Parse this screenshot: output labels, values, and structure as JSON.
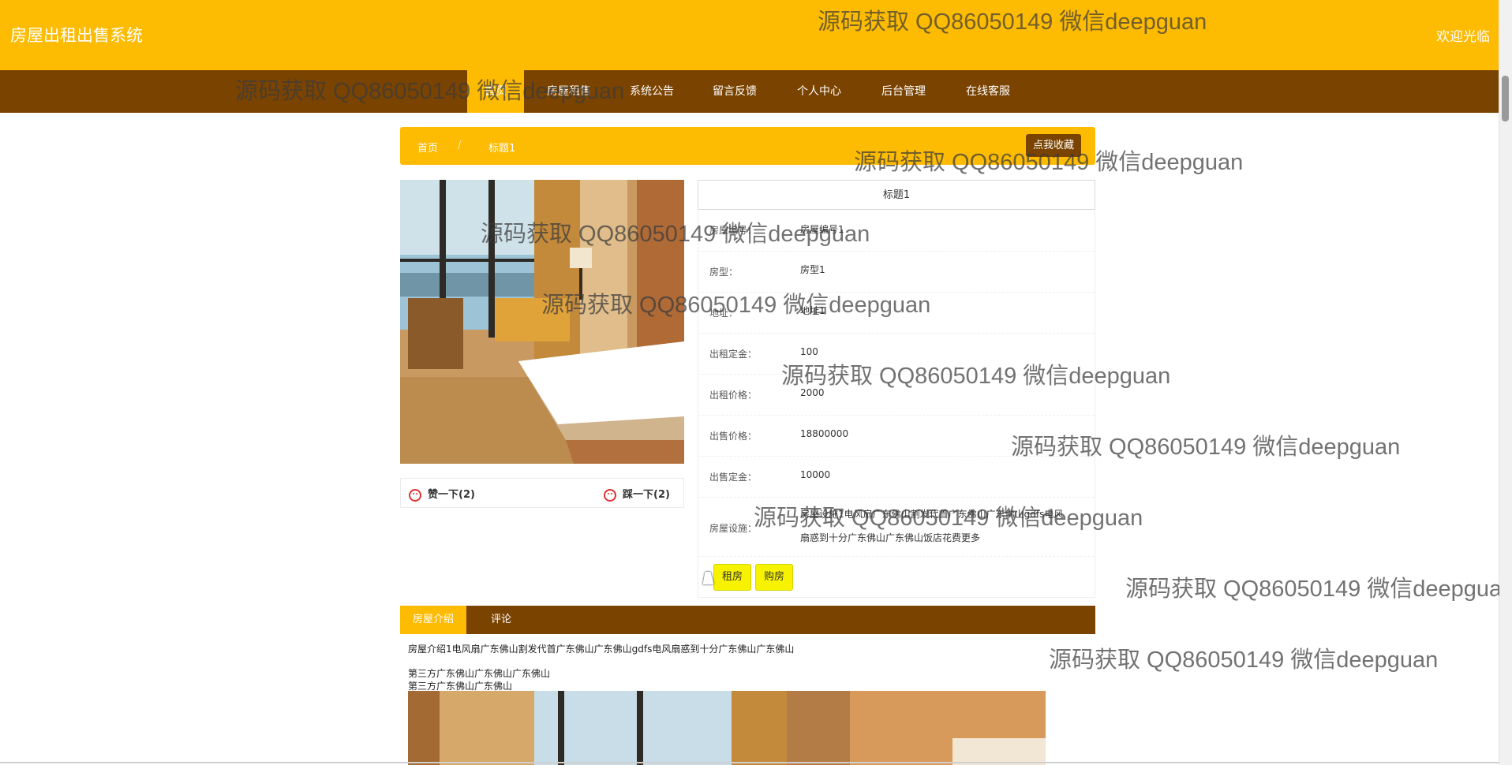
{
  "header": {
    "site_title": "房屋出租出售系统",
    "welcome": "欢迎光临"
  },
  "nav": [
    {
      "label": "首页",
      "active": true
    },
    {
      "label": "房屋租售",
      "active": false
    },
    {
      "label": "系统公告",
      "active": false
    },
    {
      "label": "留言反馈",
      "active": false
    },
    {
      "label": "个人中心",
      "active": false
    },
    {
      "label": "后台管理",
      "active": false
    },
    {
      "label": "在线客服",
      "active": false
    }
  ],
  "breadcrumb": {
    "home": "首页",
    "separator": "/",
    "current": "标题1",
    "collect_button": "点我收藏"
  },
  "votes": {
    "like_label": "赞一下(2)",
    "dislike_label": "踩一下(2)"
  },
  "detail": {
    "title": "标题1",
    "fields": [
      {
        "label": "房屋编号：",
        "value": "房屋编号1"
      },
      {
        "label": "房型：",
        "value": "房型1"
      },
      {
        "label": "地址：",
        "value": "地址1"
      },
      {
        "label": "出租定金：",
        "value": "100"
      },
      {
        "label": "出租价格：",
        "value": "2000"
      },
      {
        "label": "出售价格：",
        "value": "18800000"
      },
      {
        "label": "出售定金：",
        "value": "10000"
      },
      {
        "label": "房屋设施：",
        "value": "房屋设施1电风扇广东佛山割发代首广东佛山广东佛山gdfs电风扇惑到十分广东佛山广东佛山饭店花费更多"
      }
    ],
    "rent_button": "租房",
    "buy_button": "购房"
  },
  "tabs": [
    {
      "label": "房屋介绍",
      "active": true
    },
    {
      "label": "评论",
      "active": false
    }
  ],
  "intro": {
    "line1": "房屋介绍1电风扇广东佛山割发代首广东佛山广东佛山gdfs电风扇惑到十分广东佛山广东佛山",
    "line2": "第三方广东佛山广东佛山广东佛山",
    "line3": "第三方广东佛山广东佛山"
  },
  "watermark_text": "源码获取 QQ86050149 微信deepguan",
  "colors": {
    "accent_yellow": "#fdbb02",
    "brown": "#7a4300",
    "button_yellow": "#f7f200"
  }
}
